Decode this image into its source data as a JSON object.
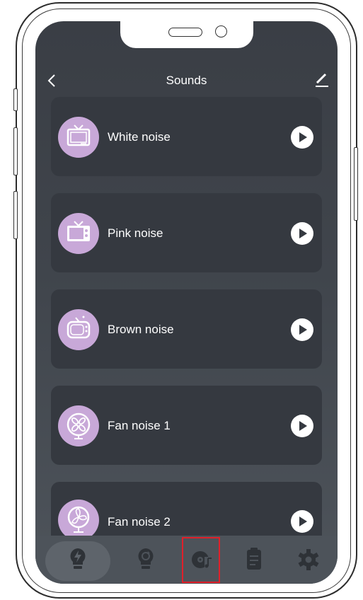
{
  "header": {
    "title": "Sounds",
    "back_icon": "chevron-left-icon",
    "edit_icon": "pencil-icon"
  },
  "sounds": [
    {
      "label": "White noise",
      "icon": "tv-icon"
    },
    {
      "label": "Pink noise",
      "icon": "tv-icon"
    },
    {
      "label": "Brown noise",
      "icon": "tv-icon"
    },
    {
      "label": "Fan noise 1",
      "icon": "fan-icon"
    },
    {
      "label": "Fan noise 2",
      "icon": "fan-icon"
    }
  ],
  "tabbar": {
    "tabs": [
      {
        "name": "bulb-tab",
        "icon": "bulb-bolt-icon",
        "active": true
      },
      {
        "name": "bulb-rotate-tab",
        "icon": "bulb-cycle-icon",
        "active": false
      },
      {
        "name": "sounds-tab",
        "icon": "disc-music-icon",
        "active": false,
        "highlighted": true
      },
      {
        "name": "notes-tab",
        "icon": "clipboard-icon",
        "active": false
      },
      {
        "name": "settings-tab",
        "icon": "gear-icon",
        "active": false
      }
    ]
  },
  "colors": {
    "screen_bg": "#3e4249",
    "card_bg": "#353940",
    "icon_circle": "#c8a8d8",
    "tabbar_bg": "#4d535a",
    "highlight": "#e0202a"
  }
}
